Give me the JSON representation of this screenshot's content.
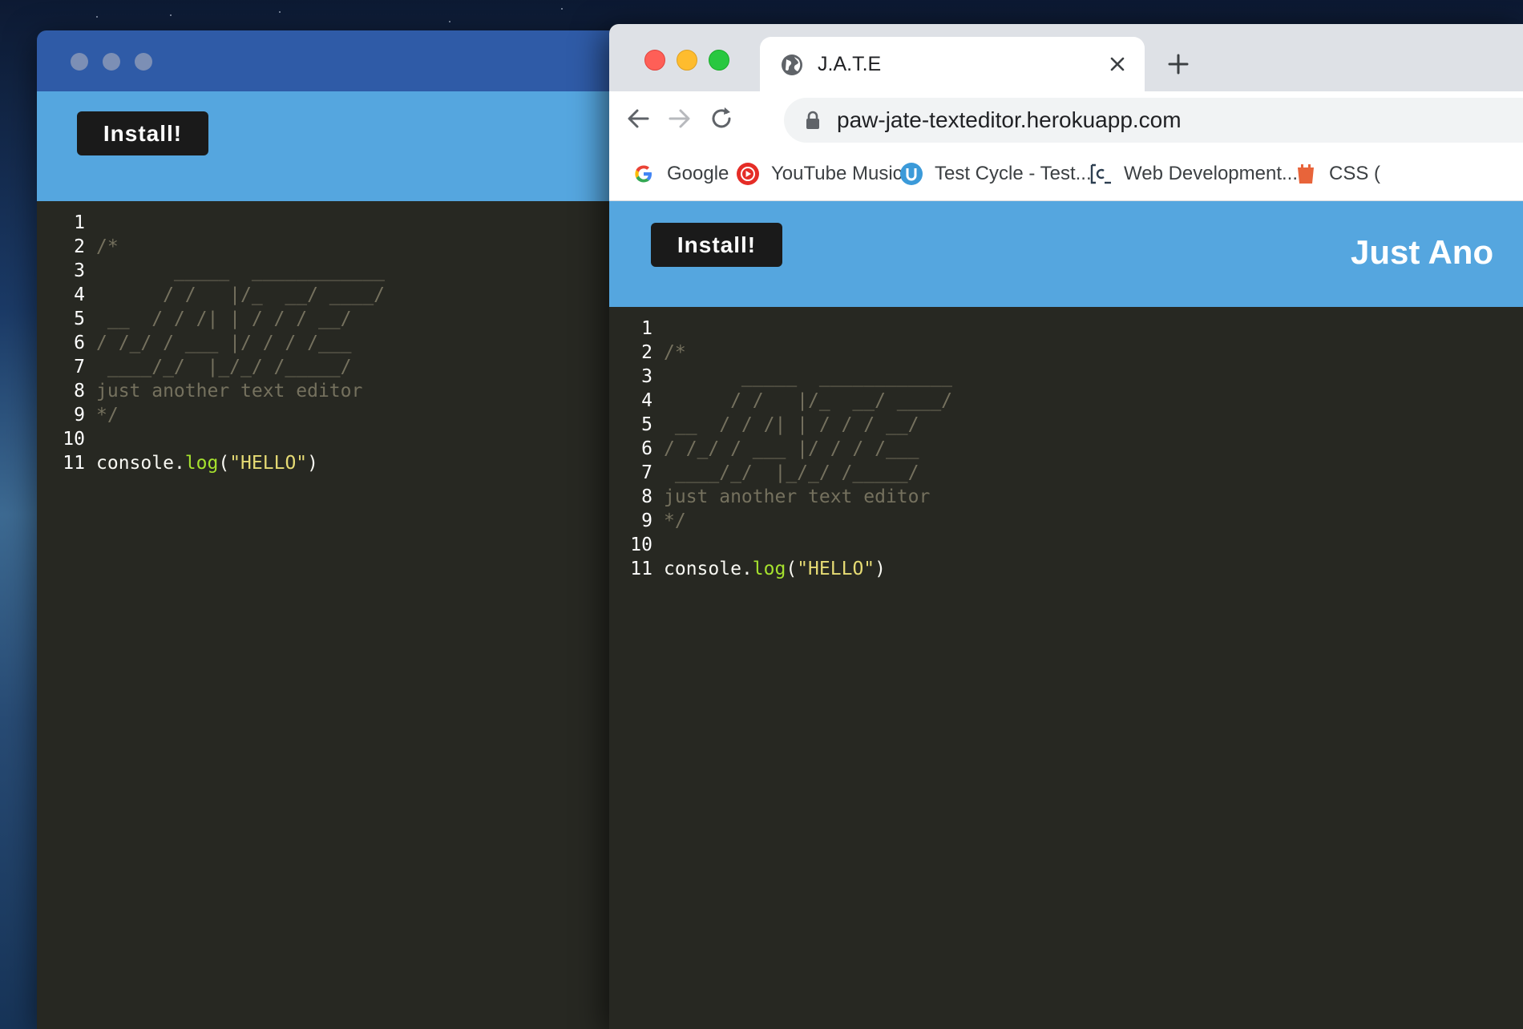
{
  "app_window": {
    "install_label": "Install!",
    "editor_lines": [
      {
        "num": "1",
        "text": "",
        "type": "plain"
      },
      {
        "num": "2",
        "text": "/*",
        "type": "comment"
      },
      {
        "num": "3",
        "text": "       _____  ____________",
        "type": "comment"
      },
      {
        "num": "4",
        "text": "      / /   |/_  __/ ____/",
        "type": "comment"
      },
      {
        "num": "5",
        "text": " __  / / /| | / / / __/",
        "type": "comment"
      },
      {
        "num": "6",
        "text": "/ /_/ / ___ |/ / / /___",
        "type": "comment"
      },
      {
        "num": "7",
        "text": " ____/_/  |_/_/ /_____/",
        "type": "comment"
      },
      {
        "num": "8",
        "text": "just another text editor",
        "type": "comment"
      },
      {
        "num": "9",
        "text": "*/",
        "type": "comment"
      },
      {
        "num": "10",
        "text": "",
        "type": "plain"
      },
      {
        "num": "11",
        "text": "",
        "type": "code"
      }
    ]
  },
  "browser": {
    "tab_title": "J.A.T.E",
    "url": "paw-jate-texteditor.herokuapp.com",
    "bookmarks": [
      {
        "label": "Google",
        "icon": "google-icon"
      },
      {
        "label": "YouTube Music",
        "icon": "youtube-music-icon"
      },
      {
        "label": "Test Cycle - Test...",
        "icon": "test-cycle-icon"
      },
      {
        "label": "Web Development...",
        "icon": "web-dev-icon"
      },
      {
        "label": "CSS (",
        "icon": "css-icon"
      }
    ],
    "install_label": "Install!",
    "app_title": "Just Ano"
  },
  "code_line_11": {
    "object": "console",
    "dot": ".",
    "method": "log",
    "open_paren": "(",
    "string": "\"HELLO\"",
    "close_paren": ")"
  },
  "colors": {
    "editor_bg": "#272822",
    "header_blue": "#55a6df",
    "titlebar_blue": "#2f5ba7",
    "comment": "#75715e",
    "function": "#a6e22e",
    "string": "#e6db74"
  }
}
